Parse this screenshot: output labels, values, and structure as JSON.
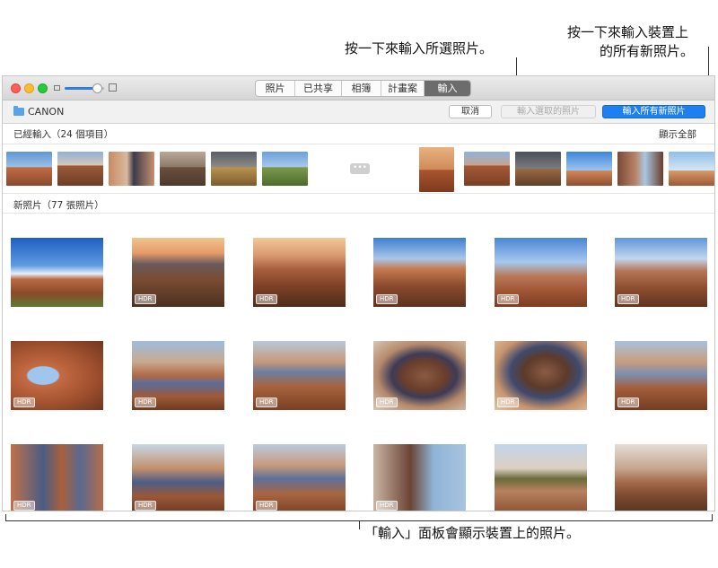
{
  "callouts": {
    "import_selected": "按一下來輸入所選照片。",
    "import_all_line1": "按一下來輸入裝置上",
    "import_all_line2": "的所有新照片。",
    "panel": "「輸入」面板會顯示裝置上的照片。"
  },
  "window": {
    "tabs": [
      "照片",
      "已共享",
      "相簿",
      "計畫案",
      "輸入"
    ],
    "active_tab": "輸入",
    "zoom_level": 0.82
  },
  "toolbar": {
    "device_name": "CANON",
    "device_icon": "folder-icon",
    "cancel_label": "取消",
    "import_selected_label": "輸入選取的照片",
    "import_all_label": "輸入所有新照片"
  },
  "already_imported": {
    "heading": "已經輸入（24 個項目）",
    "show_all": "顯示全部",
    "more_icon": "ellipsis-icon",
    "more_text": "•••"
  },
  "new_photos": {
    "heading": "新照片（77 張照片）",
    "hdr_badge": "HDR"
  },
  "colors": {
    "accent": "#1d7ff0",
    "sky": "#4d8fd6",
    "rock": "#b5553a",
    "sand": "#d9a37d"
  }
}
